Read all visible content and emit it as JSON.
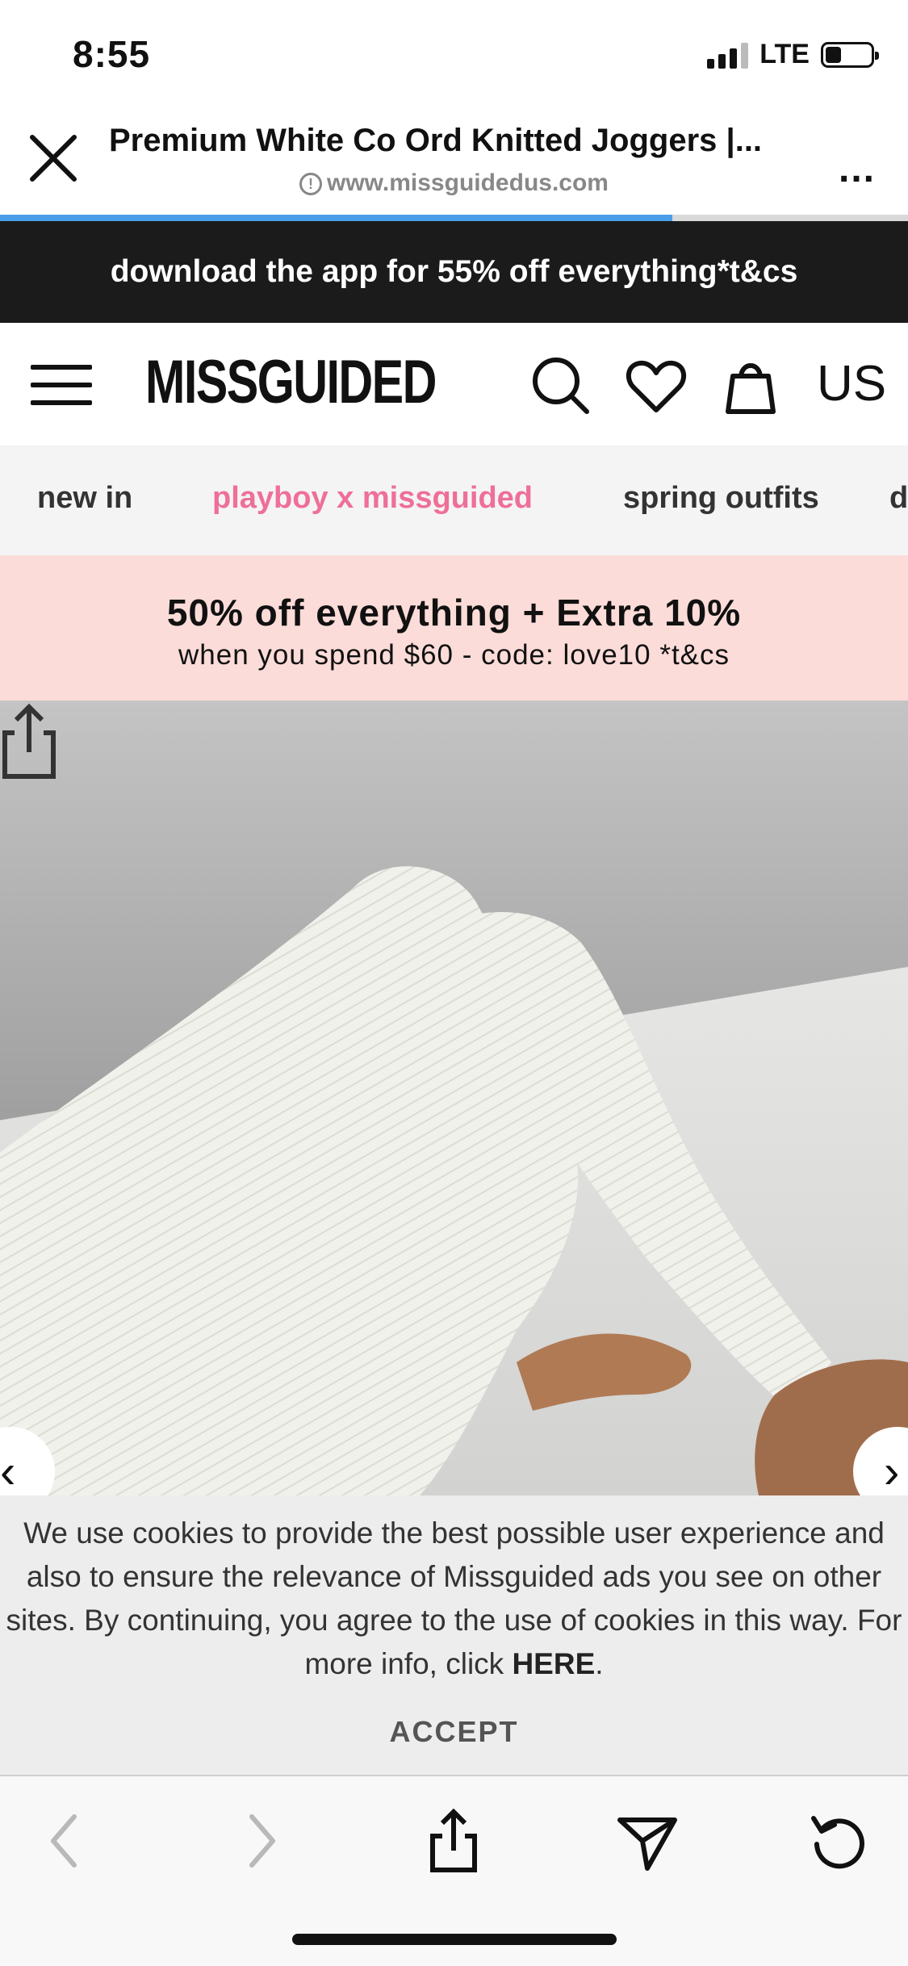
{
  "status_bar": {
    "time": "8:55",
    "network": "LTE",
    "signal_bars": 3,
    "battery_level": 0.35
  },
  "browser": {
    "page_title": "Premium White Co Ord Knitted Joggers |...",
    "url": "www.missguidedus.com",
    "load_progress": 0.74,
    "more_label": "...",
    "icons": {
      "close": "close-icon",
      "info": "info-icon",
      "more": "more-icon"
    },
    "accent_color": "#4a9ee8"
  },
  "app_banner": {
    "text": "download the app for 55% off everything*t&cs"
  },
  "site_header": {
    "logo": "MISSGUIDED",
    "region": "US",
    "icons": [
      "menu-icon",
      "search-icon",
      "heart-icon",
      "bag-icon"
    ]
  },
  "category_nav": {
    "items": [
      {
        "label": "new in"
      },
      {
        "label": "playboy x missguided",
        "highlight_color": "#ee6f98"
      },
      {
        "label": "spring outfits"
      },
      {
        "label": "d"
      }
    ]
  },
  "sale_banner": {
    "headline": "50% off everything + Extra 10%",
    "subline": "when you spend $60 - code: love10 *t&cs",
    "background_color": "#fbdcd8"
  },
  "product": {
    "image_subject": "white ribbed knitted joggers",
    "icons": [
      "share-icon",
      "chevron-left-icon",
      "chevron-right-icon"
    ]
  },
  "cookie_banner": {
    "text": "We use cookies to provide the best possible user experience and also to ensure the relevance of Missguided ads you see on other sites. By continuing, you agree to the use of cookies in this way. For more info, click",
    "link_label": "HERE",
    "text_end": ".",
    "accept_label": "ACCEPT"
  },
  "toolbar": {
    "icons": [
      "back-arrow-icon",
      "forward-arrow-icon",
      "share-icon",
      "send-icon",
      "reload-icon"
    ]
  }
}
